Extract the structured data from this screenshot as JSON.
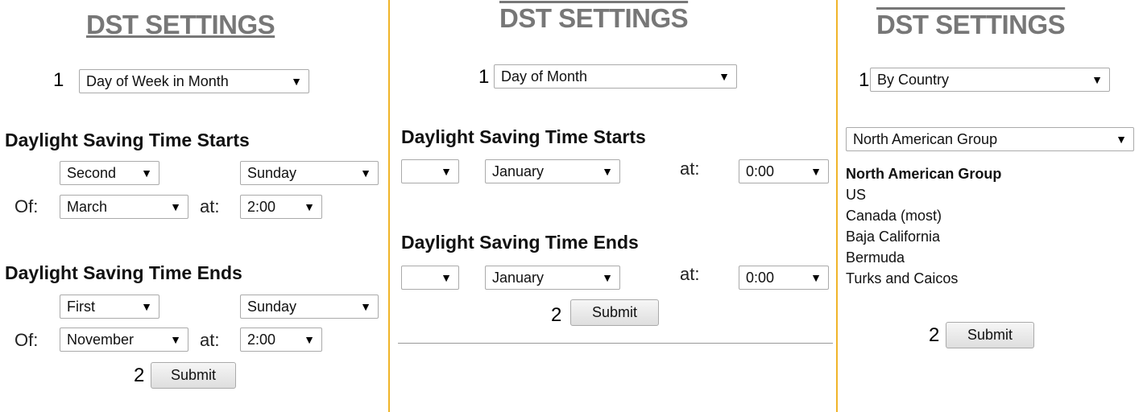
{
  "panel1": {
    "title": "DST SETTINGS",
    "step1_num": "1",
    "mode_select": "Day of Week in Month",
    "starts_heading": "Daylight Saving Time Starts",
    "starts_week": "Second",
    "starts_day": "Sunday",
    "of_label": "Of:",
    "starts_month": "March",
    "at_label": "at:",
    "starts_time": "2:00",
    "ends_heading": "Daylight Saving Time Ends",
    "ends_week": "First",
    "ends_day": "Sunday",
    "ends_month": "November",
    "ends_time": "2:00",
    "step2_num": "2",
    "submit": "Submit"
  },
  "panel2": {
    "title": "DST SETTINGS",
    "step1_num": "1",
    "mode_select": "Day of Month",
    "starts_heading": "Daylight Saving Time Starts",
    "starts_day": "",
    "starts_month": "January",
    "at_label": "at:",
    "starts_time": "0:00",
    "ends_heading": "Daylight Saving Time Ends",
    "ends_day": "",
    "ends_month": "January",
    "ends_time": "0:00",
    "step2_num": "2",
    "submit": "Submit"
  },
  "panel3": {
    "title": "DST SETTINGS",
    "step1_num": "1",
    "mode_select": "By Country",
    "group_select": "North American Group",
    "group_heading": "North American Group",
    "countries": [
      "US",
      "Canada (most)",
      "Baja California",
      "Bermuda",
      "Turks and Caicos"
    ],
    "step2_num": "2",
    "submit": "Submit"
  },
  "colors": {
    "divider": "#f0b429",
    "title": "#777777"
  },
  "icons": {
    "select_arrow": "▼"
  }
}
